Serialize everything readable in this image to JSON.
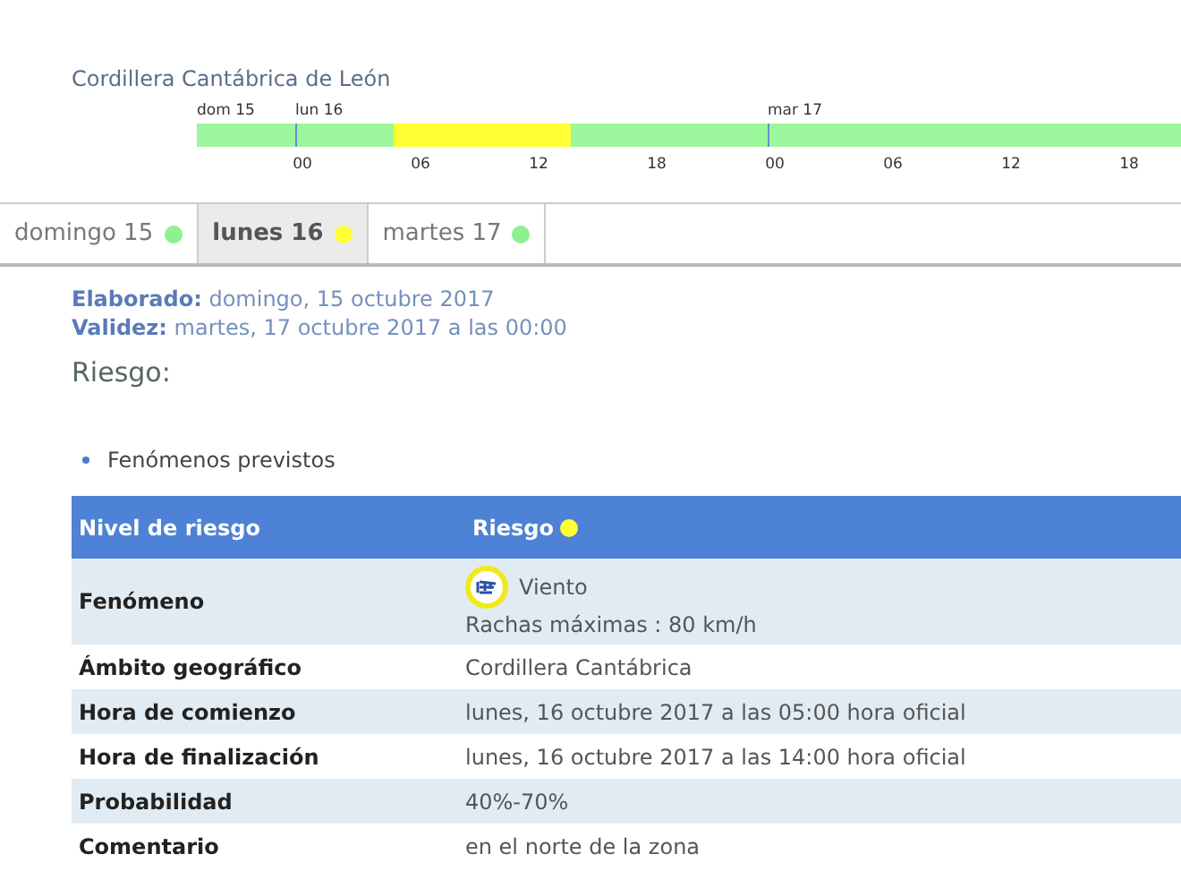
{
  "zone_title": "Cordillera Cantábrica de León",
  "timeline": {
    "day_labels": [
      "dom 15",
      "lun 16",
      "mar 17"
    ],
    "segments": [
      {
        "color": "#9cf79c"
      },
      {
        "color": "#ffff33"
      },
      {
        "color": "#9cf79c"
      }
    ],
    "hour_ticks": [
      "00",
      "06",
      "12",
      "18",
      "00",
      "06",
      "12",
      "18"
    ]
  },
  "tabs": [
    {
      "label": "domingo 15",
      "color": "#8ef08e",
      "selected": false
    },
    {
      "label": "lunes 16",
      "color": "#ffff33",
      "selected": true
    },
    {
      "label": "martes 17",
      "color": "#8ef08e",
      "selected": false
    }
  ],
  "meta": [
    {
      "label": "Elaborado:",
      "value": "domingo, 15 octubre 2017"
    },
    {
      "label": "Validez:",
      "value": "martes, 17 octubre 2017 a las 00:00"
    }
  ],
  "section_title": "Riesgo:",
  "bullet": "Fenómenos previstos",
  "table": {
    "header": {
      "column_1": "Nivel de riesgo",
      "column_2": "Riesgo",
      "color": "#ffff33"
    },
    "phenomenon": {
      "label": "Fenómeno",
      "name": "Viento",
      "detail": "Rachas máximas : 80 km/h"
    },
    "rows": [
      {
        "label": "Ámbito geográfico",
        "value": "Cordillera Cantábrica"
      },
      {
        "label": "Hora de comienzo",
        "value": "lunes, 16 octubre 2017 a las 05:00 hora oficial"
      },
      {
        "label": "Hora de finalización",
        "value": "lunes, 16 octubre 2017 a las 14:00 hora oficial"
      },
      {
        "label": "Probabilidad",
        "value": "40%-70%"
      },
      {
        "label": "Comentario",
        "value": "en el norte de la zona"
      }
    ]
  }
}
